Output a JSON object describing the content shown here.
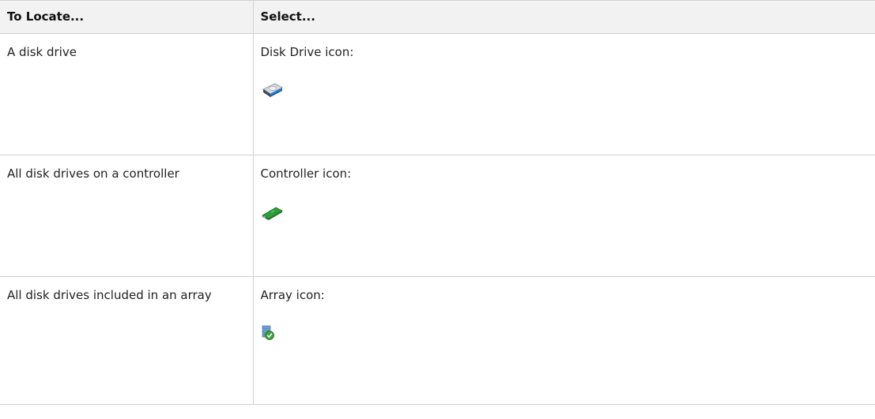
{
  "table": {
    "headers": [
      "To Locate...",
      "Select..."
    ],
    "rows": [
      {
        "locate": "A disk drive",
        "select": "Disk Drive icon:",
        "icon": "disk-drive-icon"
      },
      {
        "locate": "All disk drives on a controller",
        "select": "Controller icon:",
        "icon": "controller-icon"
      },
      {
        "locate": "All disk drives included in an array",
        "select": "Array icon:",
        "icon": "array-icon"
      }
    ]
  },
  "colors": {
    "header_bg": "#f2f2f2",
    "border": "#d2d2d2",
    "disk_blue": "#2b7fd4",
    "controller_green": "#2e9e3a",
    "array_check_green": "#3aa33a"
  }
}
